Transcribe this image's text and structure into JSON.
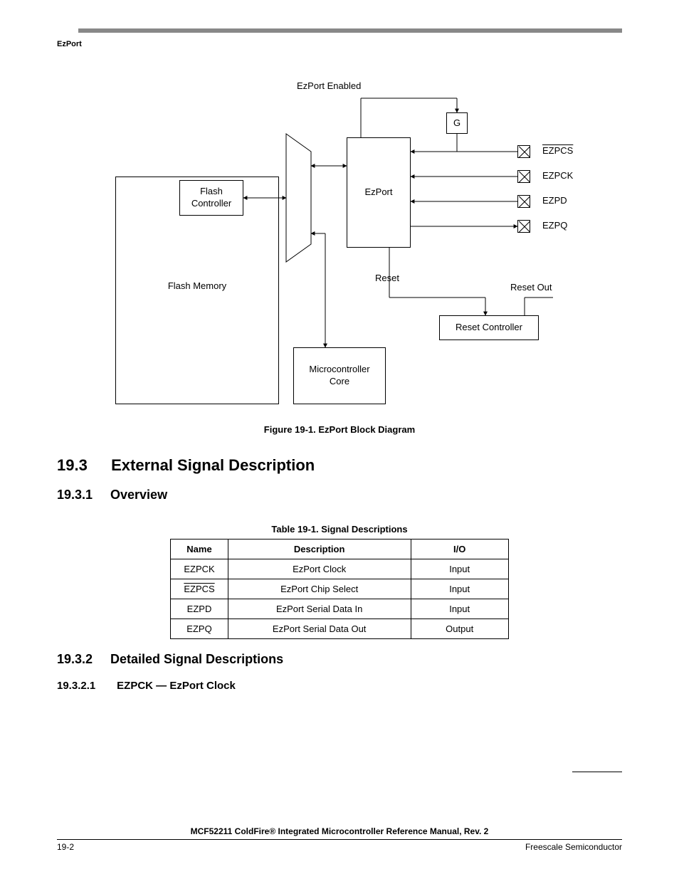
{
  "running_head": "EzPort",
  "diagram": {
    "ezport_enabled": "EzPort Enabled",
    "g": "G",
    "flash_controller": "Flash\nController",
    "ezport": "EzPort",
    "flash_memory": "Flash Memory",
    "reset": "Reset",
    "microcontroller_core": "Microcontroller\nCore",
    "reset_controller": "Reset Controller",
    "reset_out": "Reset Out",
    "pins": {
      "ezpcs": "EZPCS",
      "ezpck": "EZPCK",
      "ezpd": "EZPD",
      "ezpq": "EZPQ"
    }
  },
  "figure_caption": "Figure 19-1. EzPort Block Diagram",
  "section_19_3": {
    "num": "19.3",
    "title": "External Signal Description"
  },
  "section_19_3_1": {
    "num": "19.3.1",
    "title": "Overview"
  },
  "table_caption": "Table 19-1. Signal Descriptions",
  "table_headers": {
    "name": "Name",
    "description": "Description",
    "io": "I/O"
  },
  "table_rows": [
    {
      "name": "EZPCK",
      "overline": false,
      "desc": "EzPort Clock",
      "io": "Input"
    },
    {
      "name": "EZPCS",
      "overline": true,
      "desc": "EzPort Chip Select",
      "io": "Input"
    },
    {
      "name": "EZPD",
      "overline": false,
      "desc": "EzPort Serial Data In",
      "io": "Input"
    },
    {
      "name": "EZPQ",
      "overline": false,
      "desc": "EzPort Serial Data Out",
      "io": "Output"
    }
  ],
  "section_19_3_2": {
    "num": "19.3.2",
    "title": "Detailed Signal Descriptions"
  },
  "section_19_3_2_1": {
    "num": "19.3.2.1",
    "title": "EZPCK — EzPort Clock"
  },
  "footer_center": "MCF52211 ColdFire® Integrated Microcontroller Reference Manual, Rev. 2",
  "footer_left": "19-2",
  "footer_right": "Freescale Semiconductor"
}
